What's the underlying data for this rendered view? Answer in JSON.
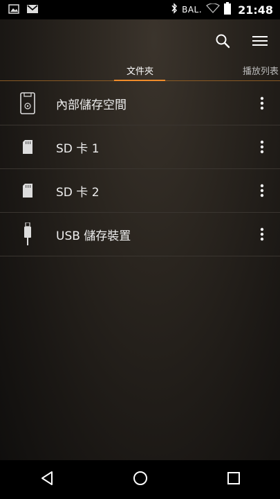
{
  "status_bar": {
    "notification_icons": [
      "image-icon",
      "gmail-icon"
    ],
    "carrier": "BAL.",
    "time": "21:48",
    "system_icons": [
      "bluetooth-icon",
      "wifi-icon",
      "battery-icon"
    ]
  },
  "app_bar": {
    "actions": [
      "search-icon",
      "menu-icon"
    ]
  },
  "tabs": [
    {
      "label": "文件夾",
      "active": true
    },
    {
      "label": "播放列表",
      "active": false
    }
  ],
  "storage_list": [
    {
      "label": "內部儲存空間",
      "icon": "internal-storage-icon"
    },
    {
      "label": "SD 卡 1",
      "icon": "sd-card-icon"
    },
    {
      "label": "SD 卡 2",
      "icon": "sd-card-icon"
    },
    {
      "label": "USB 儲存裝置",
      "icon": "usb-icon"
    }
  ],
  "colors": {
    "accent": "#f08c2a",
    "text": "#eeeeee"
  },
  "nav_bar": [
    "back-icon",
    "home-icon",
    "recents-icon"
  ]
}
